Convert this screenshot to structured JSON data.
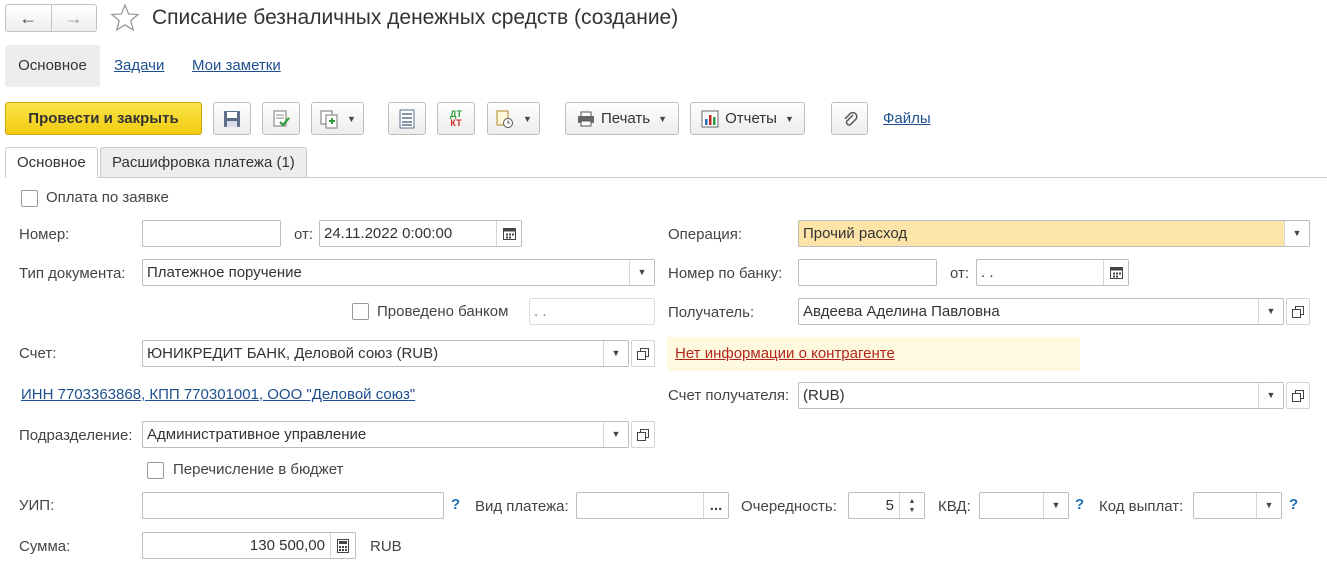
{
  "window": {
    "title": "Списание безналичных денежных средств (создание)",
    "back_icon": "arrow-left-icon",
    "forward_icon": "arrow-right-icon",
    "favorite_icon": "star-outline-icon"
  },
  "nav_tabs": [
    {
      "label": "Основное",
      "active": true
    },
    {
      "label": "Задачи"
    },
    {
      "label": "Мои заметки"
    }
  ],
  "toolbar": {
    "post_close": "Провести и закрыть",
    "print": "Печать",
    "reports": "Отчеты",
    "files": "Файлы",
    "accent_color": "#f5d01c"
  },
  "form_tabs": [
    {
      "label": "Основное",
      "active": true
    },
    {
      "label": "Расшифровка платежа (1)"
    }
  ],
  "form": {
    "by_request_label": "Оплата по заявке",
    "number_label": "Номер:",
    "number_value": "",
    "from_label": "от:",
    "date_value": "24.11.2022  0:00:00",
    "doc_type_label": "Тип документа:",
    "doc_type_value": "Платежное поручение",
    "bank_posted_label": "Проведено банком",
    "bank_posted_date": " .  .",
    "account_label": "Счет:",
    "account_value": "ЮНИКРЕДИТ БАНК, Деловой союз (RUB)",
    "org_link": "ИНН 7703363868, КПП 770301001, ООО \"Деловой союз\"",
    "division_label": "Подразделение:",
    "division_value": "Административное управление",
    "budget_label": "Перечисление в бюджет",
    "uip_label": "УИП:",
    "uip_value": "",
    "payment_kind_label": "Вид платежа:",
    "payment_kind_value": "",
    "priority_label": "Очередность:",
    "priority_value": "5",
    "kvd_label": "КВД:",
    "payout_code_label": "Код выплат:",
    "amount_label": "Сумма:",
    "amount_value": "130 500,00",
    "currency": "RUB",
    "operation_label": "Операция:",
    "operation_value": "Прочий расход",
    "bank_number_label": "Номер по банку:",
    "bank_number_value": "",
    "bank_from_label": "от:",
    "bank_date_value": " .  .",
    "recipient_label": "Получатель:",
    "recipient_value": "Авдеева Аделина Павловна",
    "no_info_warning": "Нет информации о контрагенте",
    "recipient_account_label": "Счет получателя:",
    "recipient_account_value": "(RUB)",
    "help_mark": "?",
    "ellipsis": "..."
  }
}
